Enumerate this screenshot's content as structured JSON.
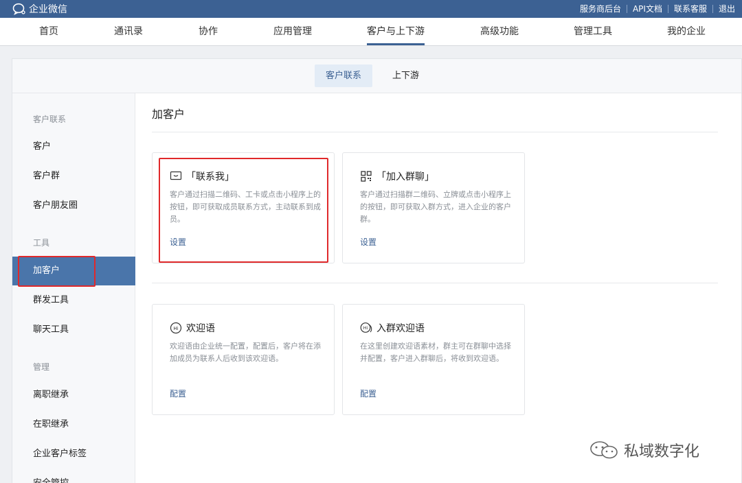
{
  "app": {
    "name": "企业微信"
  },
  "top_links": [
    "服务商后台",
    "API文档",
    "联系客服",
    "退出"
  ],
  "nav": {
    "items": [
      "首页",
      "通讯录",
      "协作",
      "应用管理",
      "客户与上下游",
      "高级功能",
      "管理工具",
      "我的企业"
    ],
    "active": "客户与上下游"
  },
  "subnav": {
    "tabs": [
      "客户联系",
      "上下游"
    ],
    "active": "客户联系"
  },
  "sidebar": {
    "group_customer": "客户联系",
    "item_customer": "客户",
    "item_group": "客户群",
    "item_moments": "客户朋友圈",
    "group_tools": "工具",
    "item_add": "加客户",
    "item_mass": "群发工具",
    "item_chat": "聊天工具",
    "group_manage": "管理",
    "item_resign": "离职继承",
    "item_onjob": "在职继承",
    "item_tags": "企业客户标签",
    "item_security": "安全管控"
  },
  "main": {
    "title": "加客户",
    "cards": [
      {
        "title": "「联系我」",
        "desc": "客户通过扫描二维码、工卡或点击小程序上的按钮，即可获取成员联系方式，主动联系到成员。",
        "link": "设置",
        "icon": "chat-window-icon"
      },
      {
        "title": "「加入群聊」",
        "desc": "客户通过扫描群二维码、立牌或点击小程序上的按钮，即可获取入群方式，进入企业的客户群。",
        "link": "设置",
        "icon": "qr-code-icon"
      },
      {
        "title": "欢迎语",
        "desc": "欢迎语由企业统一配置，配置后，客户将在添加成员为联系人后收到该欢迎语。",
        "link": "配置",
        "icon": "hi-bubble-icon"
      },
      {
        "title": "入群欢迎语",
        "desc": "在这里创建欢迎语素材，群主可在群聊中选择并配置，客户进入群聊后，将收到欢迎语。",
        "link": "配置",
        "icon": "hi-group-bubble-icon"
      }
    ]
  },
  "watermark": {
    "text": "私域数字化"
  },
  "colors": {
    "brand": "#3c6193",
    "active_sidebar": "#4a75aa",
    "highlight_box": "#e0282a"
  }
}
